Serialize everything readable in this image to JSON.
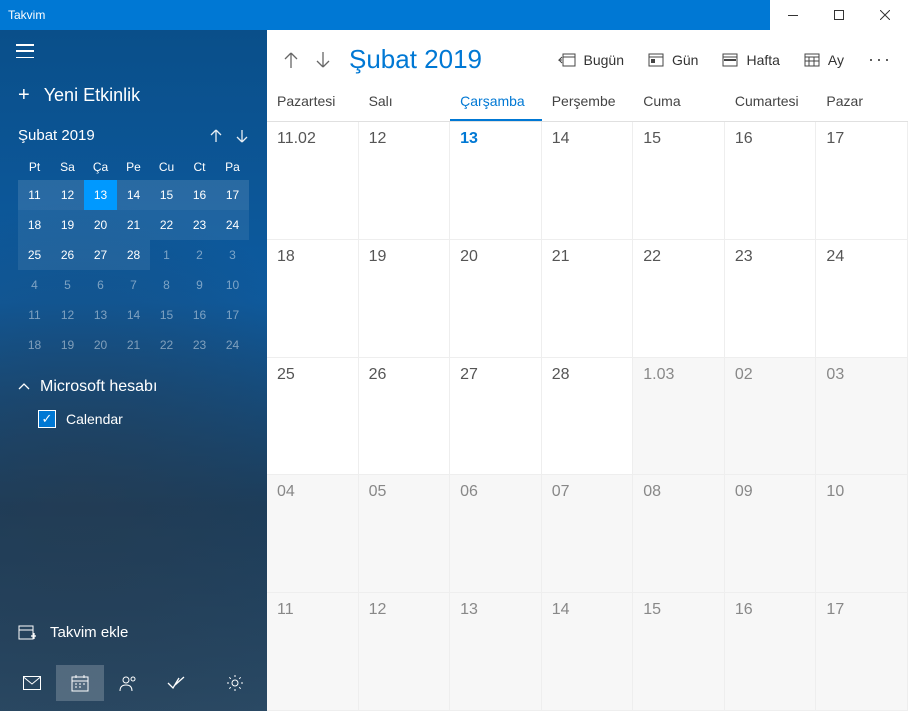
{
  "title": "Takvim",
  "sidebar": {
    "newEvent": "Yeni Etkinlik",
    "miniCal": {
      "title": "Şubat 2019",
      "dayHeaders": [
        "Pt",
        "Sa",
        "Ça",
        "Pe",
        "Cu",
        "Ct",
        "Pa"
      ],
      "weeks": [
        [
          {
            "d": "11",
            "cw": true
          },
          {
            "d": "12",
            "cw": true
          },
          {
            "d": "13",
            "cw": true,
            "today": true
          },
          {
            "d": "14",
            "cw": true
          },
          {
            "d": "15",
            "cw": true
          },
          {
            "d": "16",
            "cw": true
          },
          {
            "d": "17",
            "cw": true
          }
        ],
        [
          {
            "d": "18",
            "hl": true
          },
          {
            "d": "19",
            "hl": true
          },
          {
            "d": "20",
            "hl": true
          },
          {
            "d": "21",
            "hl": true
          },
          {
            "d": "22",
            "hl": true
          },
          {
            "d": "23",
            "hl": true
          },
          {
            "d": "24",
            "hl": true
          }
        ],
        [
          {
            "d": "25",
            "hl": true
          },
          {
            "d": "26",
            "hl": true
          },
          {
            "d": "27",
            "hl": true
          },
          {
            "d": "28",
            "hl": true
          },
          {
            "d": "1",
            "om": true
          },
          {
            "d": "2",
            "om": true
          },
          {
            "d": "3",
            "om": true
          }
        ],
        [
          {
            "d": "4",
            "om": true
          },
          {
            "d": "5",
            "om": true
          },
          {
            "d": "6",
            "om": true
          },
          {
            "d": "7",
            "om": true
          },
          {
            "d": "8",
            "om": true
          },
          {
            "d": "9",
            "om": true
          },
          {
            "d": "10",
            "om": true
          }
        ],
        [
          {
            "d": "11",
            "om": true
          },
          {
            "d": "12",
            "om": true
          },
          {
            "d": "13",
            "om": true
          },
          {
            "d": "14",
            "om": true
          },
          {
            "d": "15",
            "om": true
          },
          {
            "d": "16",
            "om": true
          },
          {
            "d": "17",
            "om": true
          }
        ],
        [
          {
            "d": "18",
            "om": true
          },
          {
            "d": "19",
            "om": true
          },
          {
            "d": "20",
            "om": true
          },
          {
            "d": "21",
            "om": true
          },
          {
            "d": "22",
            "om": true
          },
          {
            "d": "23",
            "om": true
          },
          {
            "d": "24",
            "om": true
          }
        ]
      ]
    },
    "account": {
      "title": "Microsoft hesabı",
      "calendars": [
        {
          "name": "Calendar",
          "checked": true
        }
      ]
    },
    "addCalendar": "Takvim ekle"
  },
  "main": {
    "currentMonth": "Şubat 2019",
    "viewButtons": {
      "today": "Bugün",
      "day": "Gün",
      "week": "Hafta",
      "month": "Ay"
    },
    "weekdays": [
      {
        "label": "Pazartesi"
      },
      {
        "label": "Salı"
      },
      {
        "label": "Çarşamba",
        "today": true
      },
      {
        "label": "Perşembe"
      },
      {
        "label": "Cuma"
      },
      {
        "label": "Cumartesi"
      },
      {
        "label": "Pazar"
      }
    ],
    "grid": [
      [
        {
          "d": "11.02"
        },
        {
          "d": "12"
        },
        {
          "d": "13",
          "today": true
        },
        {
          "d": "14"
        },
        {
          "d": "15"
        },
        {
          "d": "16"
        },
        {
          "d": "17"
        }
      ],
      [
        {
          "d": "18"
        },
        {
          "d": "19"
        },
        {
          "d": "20"
        },
        {
          "d": "21"
        },
        {
          "d": "22"
        },
        {
          "d": "23"
        },
        {
          "d": "24"
        }
      ],
      [
        {
          "d": "25"
        },
        {
          "d": "26"
        },
        {
          "d": "27"
        },
        {
          "d": "28"
        },
        {
          "d": "1.03",
          "om": true
        },
        {
          "d": "02",
          "om": true
        },
        {
          "d": "03",
          "om": true
        }
      ],
      [
        {
          "d": "04",
          "om": true
        },
        {
          "d": "05",
          "om": true
        },
        {
          "d": "06",
          "om": true
        },
        {
          "d": "07",
          "om": true
        },
        {
          "d": "08",
          "om": true
        },
        {
          "d": "09",
          "om": true
        },
        {
          "d": "10",
          "om": true
        }
      ],
      [
        {
          "d": "11",
          "om": true
        },
        {
          "d": "12",
          "om": true
        },
        {
          "d": "13",
          "om": true
        },
        {
          "d": "14",
          "om": true
        },
        {
          "d": "15",
          "om": true
        },
        {
          "d": "16",
          "om": true
        },
        {
          "d": "17",
          "om": true
        }
      ]
    ]
  }
}
